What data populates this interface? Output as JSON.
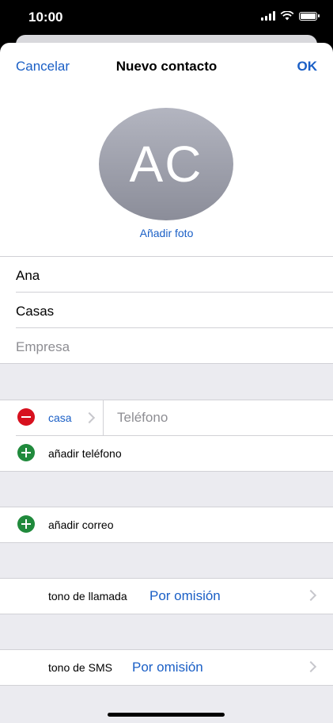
{
  "status_bar": {
    "time": "10:00"
  },
  "nav": {
    "cancel": "Cancelar",
    "title": "Nuevo contacto",
    "ok": "OK"
  },
  "avatar": {
    "initials": "AC",
    "add_photo": "Añadir foto"
  },
  "fields": {
    "first_name": "Ana",
    "last_name": "Casas",
    "company_placeholder": "Empresa"
  },
  "phone": {
    "label": "casa",
    "placeholder": "Teléfono",
    "add_phone": "añadir teléfono"
  },
  "email": {
    "add_email": "añadir correo"
  },
  "ringtone": {
    "label": "tono de llamada",
    "value": "Por omisión"
  },
  "sms_tone": {
    "label": "tono de SMS",
    "value": "Por omisión"
  },
  "colors": {
    "accent": "#1a5fc6",
    "delete": "#d7101e",
    "add": "#208a3c"
  }
}
